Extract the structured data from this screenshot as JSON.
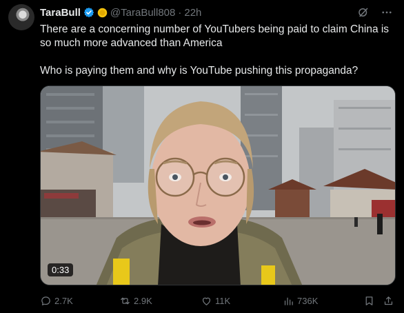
{
  "tweet": {
    "author_name": "TaraBull",
    "handle": "@TaraBull808",
    "separator": "·",
    "time": "22h",
    "text_paragraphs": [
      "There are a concerning number of YouTubers being paid to claim China is so much more advanced than America",
      "Who is paying them and why is YouTube pushing this propaganda?"
    ],
    "video_duration": "0:33"
  },
  "actions": {
    "replies": "2.7K",
    "reposts": "2.9K",
    "likes": "11K",
    "views": "736K"
  },
  "colors": {
    "background": "#000000",
    "text": "#e7e9ea",
    "muted": "#71767b",
    "verified_blue": "#1d9bf0",
    "gold_badge": "#f4c20d"
  },
  "icons": [
    "verified-icon",
    "gold-badge-icon",
    "grok-icon",
    "more-icon",
    "reply-icon",
    "repost-icon",
    "like-icon",
    "views-icon",
    "bookmark-icon",
    "share-icon"
  ]
}
